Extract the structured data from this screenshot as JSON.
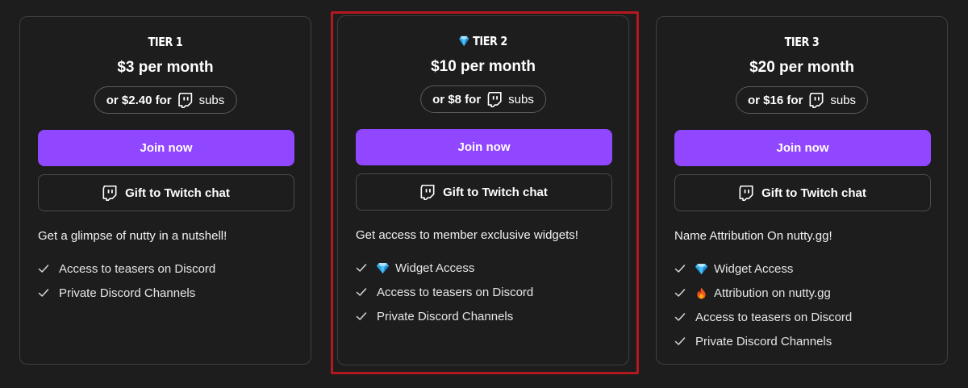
{
  "tiers": [
    {
      "name": "TIER 1",
      "price": "$3 per month",
      "subs_prefix": "or $2.40 for",
      "subs_suffix": "subs",
      "join_label": "Join now",
      "gift_label": "Gift to Twitch chat",
      "description": "Get a glimpse of nutty in a nutshell!",
      "features": [
        {
          "label": "Access to teasers on Discord"
        },
        {
          "label": "Private Discord Channels"
        }
      ]
    },
    {
      "name": "TIER 2",
      "name_icon": "diamond-icon",
      "price": "$10 per month",
      "subs_prefix": "or $8 for",
      "subs_suffix": "subs",
      "join_label": "Join now",
      "gift_label": "Gift to Twitch chat",
      "description": "Get access to member exclusive widgets!",
      "features": [
        {
          "label": "Widget Access",
          "icon": "diamond-icon"
        },
        {
          "label": "Access to teasers on Discord"
        },
        {
          "label": "Private Discord Channels"
        }
      ]
    },
    {
      "name": "TIER 3",
      "price": "$20 per month",
      "subs_prefix": "or $16 for",
      "subs_suffix": "subs",
      "join_label": "Join now",
      "gift_label": "Gift to Twitch chat",
      "description": "Name Attribution On nutty.gg!",
      "features": [
        {
          "label": "Widget Access",
          "icon": "diamond-icon"
        },
        {
          "label": "Attribution on nutty.gg",
          "icon": "fire-icon"
        },
        {
          "label": "Access to teasers on Discord"
        },
        {
          "label": "Private Discord Channels"
        }
      ]
    }
  ],
  "colors": {
    "background": "#1e1d1e",
    "accent": "#9146ff",
    "card_border": "#3e3d40",
    "selection_border": "#b3191e"
  }
}
